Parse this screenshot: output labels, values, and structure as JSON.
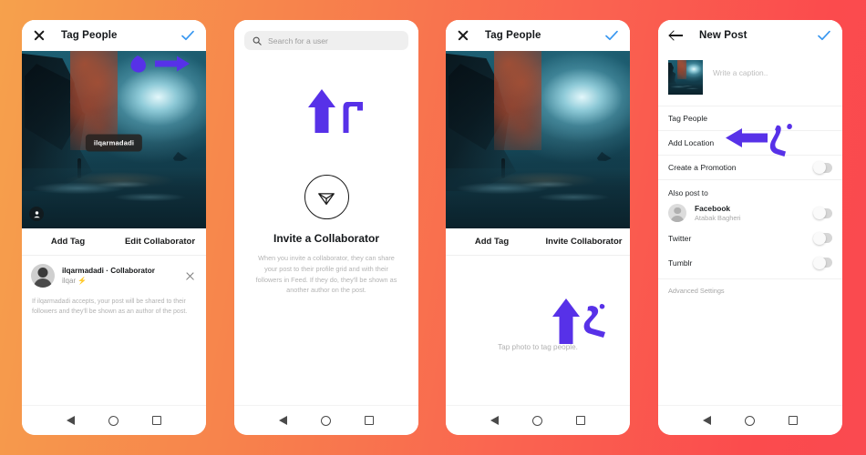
{
  "background": {
    "gradient_from": "#f6a14c",
    "gradient_to": "#fb4b4d"
  },
  "accent": {
    "annotation_purple": "#5731e8",
    "action_blue": "#3897f0"
  },
  "phones": {
    "phone1": {
      "appbar": {
        "close_icon": "close-icon",
        "title": "Tag People",
        "confirm_icon": "check-icon"
      },
      "photo": {
        "tag_label": "ilqarmadadi",
        "badge_icon": "person-icon"
      },
      "actions": {
        "left": "Add Tag",
        "right": "Edit Collaborator"
      },
      "collaborator": {
        "name": "ilqarmadadi · Collaborator",
        "subtitle": "ilqar ⚡",
        "remove_icon": "close-icon",
        "note": "If ilqarmadadi accepts, your post will be shared to their followers and they'll be shown as an author of the post."
      },
      "annotation": {
        "number": "۵",
        "arrow": "arrow-right"
      }
    },
    "phone2": {
      "search": {
        "icon": "search-icon",
        "placeholder": "Search for a user",
        "value": ""
      },
      "empty_state": {
        "icon": "send-icon",
        "title": "Invite a Collaborator",
        "body": "When you invite a collaborator, they can share your post to their profile grid and with their followers in Feed. If they do, they'll be shown as another author on the post."
      },
      "annotation": {
        "number": "۴",
        "arrow": "arrow-up"
      }
    },
    "phone3": {
      "appbar": {
        "close_icon": "close-icon",
        "title": "Tag People",
        "confirm_icon": "check-icon"
      },
      "actions": {
        "left": "Add Tag",
        "right": "Invite Collaborator"
      },
      "hint": "Tap photo to tag people.",
      "annotation": {
        "number": "۳",
        "arrow": "arrow-up"
      }
    },
    "phone4": {
      "appbar": {
        "back_icon": "back-arrow-icon",
        "title": "New Post",
        "confirm_icon": "check-icon"
      },
      "caption": {
        "placeholder": "Write a caption..",
        "value": ""
      },
      "rows": [
        {
          "label": "Tag People",
          "toggle": false
        },
        {
          "label": "Add Location",
          "toggle": false
        },
        {
          "label": "Create a Promotion",
          "toggle": true
        }
      ],
      "also_post_to": {
        "heading": "Also post to",
        "items": [
          {
            "label": "Facebook",
            "sub": "Atabak Bagheri",
            "toggle": true,
            "avatar": true
          },
          {
            "label": "Twitter",
            "sub": "",
            "toggle": true,
            "avatar": false
          },
          {
            "label": "Tumblr",
            "sub": "",
            "toggle": true,
            "avatar": false
          }
        ]
      },
      "advanced": "Advanced Settings",
      "annotation": {
        "number": "۲",
        "arrow": "arrow-left"
      }
    }
  },
  "navbar": {
    "back_icon": "nav-back-icon",
    "home_icon": "nav-home-icon",
    "recents_icon": "nav-recents-icon"
  }
}
